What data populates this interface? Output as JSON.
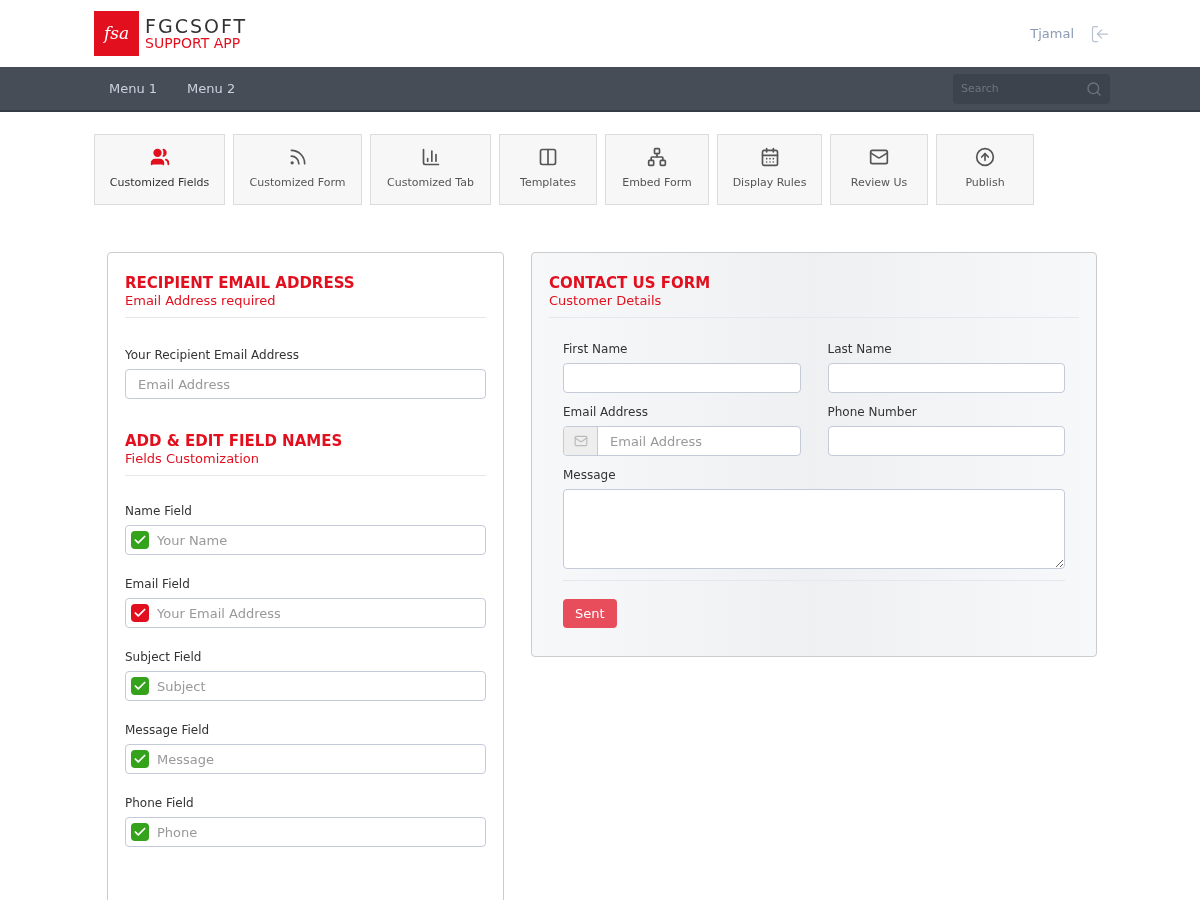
{
  "brand": {
    "logo": "fsa",
    "name": "FGCSOFT",
    "subtitle": "SUPPORT APP"
  },
  "user": {
    "name": "Tjamal"
  },
  "nav": {
    "items": [
      "Menu 1",
      "Menu 2"
    ],
    "search": {
      "placeholder": "Search"
    }
  },
  "toolbar": [
    {
      "label": "Customized Fields",
      "selected": true
    },
    {
      "label": "Customized Form",
      "selected": false
    },
    {
      "label": "Customized Tab",
      "selected": false
    },
    {
      "label": "Templates",
      "selected": false
    },
    {
      "label": "Embed Form",
      "selected": false
    },
    {
      "label": "Display Rules",
      "selected": false
    },
    {
      "label": "Review Us",
      "selected": false
    },
    {
      "label": "Publish",
      "selected": false
    }
  ],
  "recipient": {
    "title": "RECIPIENT EMAIL ADDRESS",
    "subtitle": "Email Address required",
    "label": "Your Recipient Email Address",
    "placeholder": "Email Address"
  },
  "fields_section": {
    "title": "ADD & EDIT FIELD NAMES",
    "subtitle": "Fields Customization",
    "fields": [
      {
        "label": "Name Field",
        "placeholder": "Your Name",
        "color": "#34a21a"
      },
      {
        "label": "Email Field",
        "placeholder": "Your Email Address",
        "color": "#e2101f"
      },
      {
        "label": "Subject Field",
        "placeholder": "Subject",
        "color": "#34a21a"
      },
      {
        "label": "Message Field",
        "placeholder": "Message",
        "color": "#34a21a"
      },
      {
        "label": "Phone Field",
        "placeholder": "Phone",
        "color": "#34a21a"
      }
    ]
  },
  "contact_form": {
    "title": "CONTACT US FORM",
    "subtitle": "Customer Details",
    "first_name": {
      "label": "First Name"
    },
    "last_name": {
      "label": "Last Name"
    },
    "email": {
      "label": "Email Address",
      "placeholder": "Email Address"
    },
    "phone": {
      "label": "Phone Number"
    },
    "message": {
      "label": "Message"
    },
    "submit": "Sent"
  }
}
